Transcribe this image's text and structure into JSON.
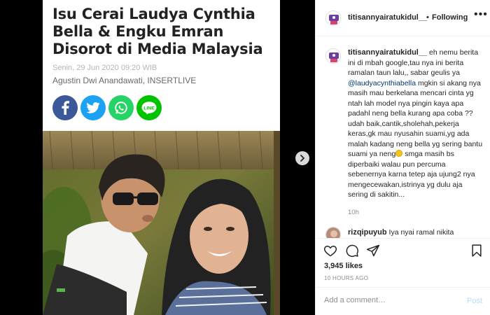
{
  "article": {
    "title": "Isu Cerai Laudya Cynthia Bella & Engku Emran Disorot di Media Malaysia",
    "date": "Senin, 29 Jun 2020 09:20 WIB",
    "author": "Agustin Dwi Anandawati, INSERTLIVE",
    "share_buttons": [
      {
        "name": "facebook",
        "color": "#3b5998"
      },
      {
        "name": "twitter",
        "color": "#1da1f2"
      },
      {
        "name": "whatsapp",
        "color": "#25d366"
      },
      {
        "name": "line",
        "color": "#00c300"
      }
    ],
    "line_label": "LINE"
  },
  "header": {
    "username": "titisannyairatukidul__",
    "separator": "•",
    "follow_label": "Following",
    "more_label": "•••"
  },
  "caption": {
    "username": "titisannyairatukidul__",
    "text_before": " eh nemu berita ini di mbah google,tau nya ini berita ramalan taun lalu,, sabar geulis ya ",
    "mention": "@laudyacynthiabella",
    "text_mid": " mgkin si akang nya masih mau berkelana mencari cinta yg ntah lah model nya pingin kaya apa padahl neng bella kurang apa coba ?? udah baik,cantik,sholehah,pekerja keras,gk mau nyusahin suami,yg ada malah kadang neng bella yg sering bantu suami ya neng",
    "text_after": " smga masih bs diperbaiki walau pun percuma sebenernya karna tetep aja ujung2 nya mengecewakan,istrinya yg dulu aja sering di sakitin...",
    "time": "10h"
  },
  "next_comment": {
    "username": "rizqipuyub",
    "text": " Iya nyai ramal nikita"
  },
  "actions": {
    "likes": "3,945 likes",
    "age": "10 HOURS AGO"
  },
  "comment_box": {
    "placeholder": "Add a comment…",
    "post_label": "Post"
  },
  "colors": {
    "accent_link": "#00376b",
    "post_disabled": "#b2dffc",
    "muted": "#8e8e8e"
  }
}
